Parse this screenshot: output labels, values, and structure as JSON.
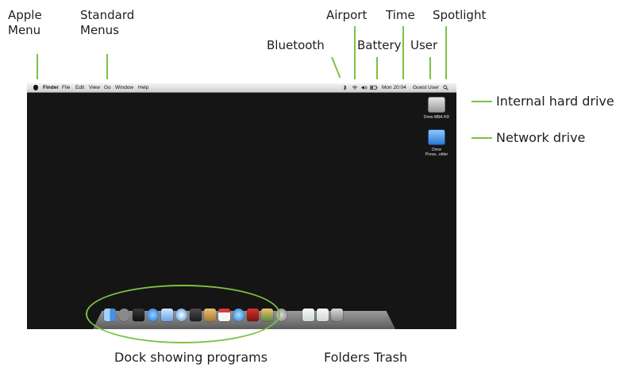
{
  "callouts": {
    "apple_menu": "Apple\nMenu",
    "standard_menus": "Standard\nMenus",
    "bluetooth": "Bluetooth",
    "airport": "Airport",
    "battery": "Battery",
    "time": "Time",
    "user": "User",
    "spotlight": "Spotlight",
    "internal_hard_drive": "Internal hard drive",
    "network_drive": "Network drive",
    "dock_programs": "Dock showing programs",
    "folders_trash": "Folders Trash"
  },
  "menubar": {
    "app": "Finder",
    "items": [
      "File",
      "Edit",
      "View",
      "Go",
      "Window",
      "Help"
    ],
    "clock": "Mon 20:04",
    "user": "Guest User"
  },
  "desktop": {
    "internal_drive_label": "Drew MBA HD",
    "network_drive_label": "Drew\nPreva...older"
  },
  "colors": {
    "accent_green": "#7cc142",
    "screen_background": "#151515"
  },
  "icons": {
    "menubar": [
      "apple-logo-icon",
      "bluetooth-icon",
      "airport-wifi-icon",
      "volume-icon",
      "battery-icon",
      "spotlight-icon"
    ],
    "dock": [
      "finder-icon",
      "launchpad-icon",
      "mission-control-icon",
      "app-store-icon",
      "preview-icon",
      "safari-icon",
      "facetime-icon",
      "address-book-icon",
      "calendar-icon",
      "itunes-icon",
      "photo-booth-icon",
      "iphoto-icon",
      "system-preferences-icon",
      "folder-icon",
      "folder-icon",
      "trash-icon"
    ]
  }
}
